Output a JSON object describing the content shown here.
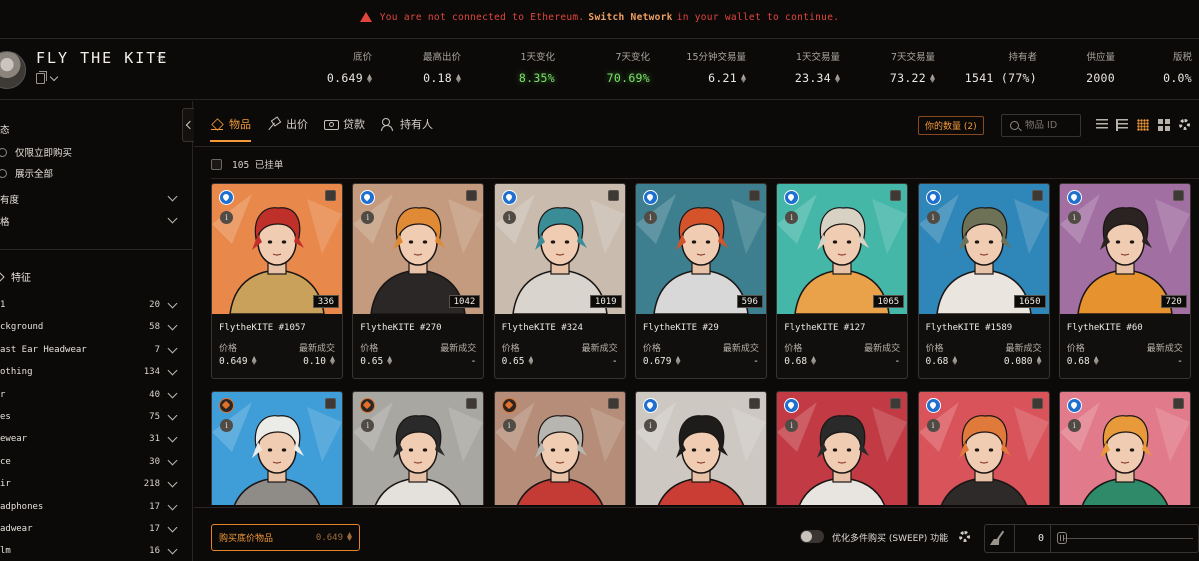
{
  "banner": {
    "pre": "You are not connected to Ethereum.",
    "link": "Switch Network",
    "post": "in your wallet to continue."
  },
  "collection": {
    "name": "FLY THE KITE",
    "star": "☆",
    "stats": [
      {
        "label": "底价",
        "value": "0.649",
        "eth": true,
        "color": "#ece8e3"
      },
      {
        "label": "最高出价",
        "value": "0.18",
        "eth": true,
        "color": "#ece8e3"
      },
      {
        "label": "1天变化",
        "value": "8.35%",
        "eth": false,
        "color": "#7de06a"
      },
      {
        "label": "7天变化",
        "value": "70.69%",
        "eth": false,
        "color": "#7de06a"
      },
      {
        "label": "15分钟交易量",
        "value": "6.21",
        "eth": true,
        "color": "#ece8e3"
      },
      {
        "label": "1天交易量",
        "value": "23.34",
        "eth": true,
        "color": "#ece8e3"
      },
      {
        "label": "7天交易量",
        "value": "73.22",
        "eth": true,
        "color": "#ece8e3"
      },
      {
        "label": "持有者",
        "value": "1541 (77%)",
        "eth": false,
        "color": "#ece8e3"
      },
      {
        "label": "供应量",
        "value": "2000",
        "eth": false,
        "color": "#ece8e3"
      },
      {
        "label": "版税",
        "value": "0.0%",
        "eth": false,
        "color": "#ece8e3"
      }
    ]
  },
  "sidebar": {
    "status_label": "态",
    "radio_buy_now": "仅限立即购买",
    "radio_show_all": "展示全部",
    "rarity_label": "有度",
    "price_label": "格",
    "traits_header": "特征",
    "traits": [
      {
        "name": "1",
        "count": "20"
      },
      {
        "name": "ckground",
        "count": "58"
      },
      {
        "name": "ast Ear Headwear",
        "count": "7"
      },
      {
        "name": "othing",
        "count": "134"
      },
      {
        "name": "r",
        "count": "40"
      },
      {
        "name": "es",
        "count": "75"
      },
      {
        "name": "ewear",
        "count": "31"
      },
      {
        "name": "ce",
        "count": "30"
      },
      {
        "name": "ir",
        "count": "218"
      },
      {
        "name": "adphones",
        "count": "17"
      },
      {
        "name": "adwear",
        "count": "17"
      },
      {
        "name": "lm",
        "count": "16"
      }
    ]
  },
  "tabs": [
    {
      "label": "物品",
      "icon": "layers-icon"
    },
    {
      "label": "出价",
      "icon": "hammer-icon"
    },
    {
      "label": "贷款",
      "icon": "loan-icon"
    },
    {
      "label": "持有人",
      "icon": "users-icon"
    }
  ],
  "toolbar": {
    "your_quantity": "你的数量 (2)",
    "search_placeholder": "物品 ID",
    "listed": "105 已挂单"
  },
  "cards_labels": {
    "price": "价格",
    "last_sale": "最新成交"
  },
  "cards": [
    {
      "name": "FlytheKITE #1057",
      "rank": "336",
      "price": "0.649",
      "last_sale": "0.10",
      "bg": "#e8894b",
      "hair": "#c0302a",
      "shirt": "#c9a15a",
      "badge": "blue"
    },
    {
      "name": "FlytheKITE #270",
      "rank": "1042",
      "price": "0.65",
      "last_sale": "-",
      "bg": "#c49b7e",
      "hair": "#e08a35",
      "shirt": "#2b2726",
      "badge": "blue"
    },
    {
      "name": "FlytheKITE #324",
      "rank": "1019",
      "price": "0.65",
      "last_sale": "-",
      "bg": "#c9bcaf",
      "hair": "#3a8c96",
      "shirt": "#d9d4ce",
      "badge": "blue"
    },
    {
      "name": "FlytheKITE #29",
      "rank": "596",
      "price": "0.679",
      "last_sale": "-",
      "bg": "#3d7f8f",
      "hair": "#d4532b",
      "shirt": "#d8d8d8",
      "badge": "blue"
    },
    {
      "name": "FlytheKITE #127",
      "rank": "1065",
      "price": "0.68",
      "last_sale": "-",
      "bg": "#44b7a8",
      "hair": "#d8d2c4",
      "shirt": "#e9a24a",
      "badge": "blue"
    },
    {
      "name": "FlytheKITE #1589",
      "rank": "1650",
      "price": "0.68",
      "last_sale": "0.080",
      "bg": "#2f86b8",
      "hair": "#6d7256",
      "shirt": "#eae5df",
      "badge": "blue"
    },
    {
      "name": "FlytheKITE #60",
      "rank": "720",
      "price": "0.68",
      "last_sale": "-",
      "bg": "#a26fa2",
      "hair": "#2a2322",
      "shirt": "#e6922f",
      "badge": "blue"
    },
    {
      "name": "",
      "rank": "",
      "price": "",
      "last_sale": "",
      "bg": "#3f9ed8",
      "hair": "#ebebe8",
      "shirt": "#8f8c88",
      "badge": "orange"
    },
    {
      "name": "",
      "rank": "",
      "price": "",
      "last_sale": "",
      "bg": "#a9a7a2",
      "hair": "#2a2a2a",
      "shirt": "#e4e1dc",
      "badge": "orange"
    },
    {
      "name": "",
      "rank": "",
      "price": "",
      "last_sale": "",
      "bg": "#b58d78",
      "hair": "#b8b6b1",
      "shirt": "#c43a35",
      "badge": "orange"
    },
    {
      "name": "",
      "rank": "",
      "price": "",
      "last_sale": "",
      "bg": "#cdc8c2",
      "hair": "#1e1c1b",
      "shirt": "#c93d35",
      "badge": "blue"
    },
    {
      "name": "",
      "rank": "",
      "price": "",
      "last_sale": "",
      "bg": "#c23b44",
      "hair": "#2a2a2a",
      "shirt": "#e8e4df",
      "badge": "blue"
    },
    {
      "name": "",
      "rank": "",
      "price": "",
      "last_sale": "",
      "bg": "#d9535b",
      "hair": "#e07a3a",
      "shirt": "#2d2a29",
      "badge": "blue"
    },
    {
      "name": "",
      "rank": "",
      "price": "",
      "last_sale": "",
      "bg": "#e17a8a",
      "hair": "#e89a3a",
      "shirt": "#2f8a6a",
      "badge": "blue"
    }
  ],
  "bottom": {
    "buy_floor": "购买底价物品",
    "buy_floor_price": "0.649",
    "sweep_label": "优化多件购买 (SWEEP) 功能",
    "sweep_count": "0"
  }
}
